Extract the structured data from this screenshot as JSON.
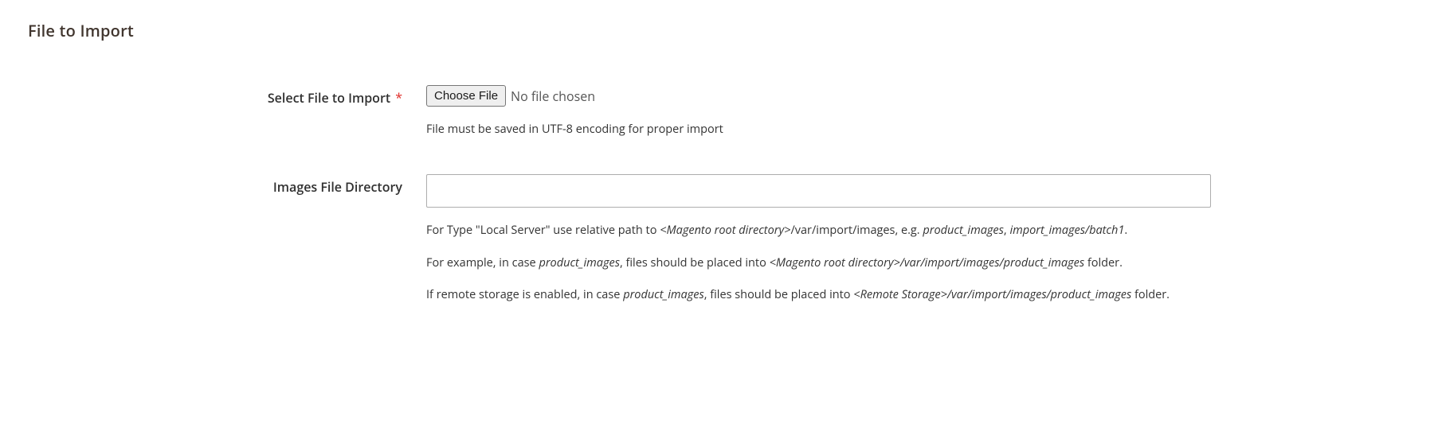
{
  "section": {
    "title": "File to Import"
  },
  "fields": {
    "select_file": {
      "label": "Select File to Import",
      "required_marker": "*",
      "button_label": "Choose File",
      "status_text": "No file chosen",
      "note": "File must be saved in UTF-8 encoding for proper import"
    },
    "images_dir": {
      "label": "Images File Directory",
      "value": "",
      "notes": {
        "p1_a": "For Type \"Local Server\" use relative path to ",
        "p1_i1": "<Magento root directory>",
        "p1_b": "/var/import/images, e.g. ",
        "p1_i2": "product_images",
        "p1_c": ", ",
        "p1_i3": "import_images/batch1",
        "p1_d": ".",
        "p2_a": "For example, in case ",
        "p2_i1": "product_images",
        "p2_b": ", files should be placed into ",
        "p2_i2": "<Magento root directory>/var/import/images/product_images",
        "p2_c": " folder.",
        "p3_a": "If remote storage is enabled, in case ",
        "p3_i1": "product_images",
        "p3_b": ", files should be placed into ",
        "p3_i2": "<Remote Storage>/var/import/images/product_images",
        "p3_c": " folder."
      }
    }
  }
}
